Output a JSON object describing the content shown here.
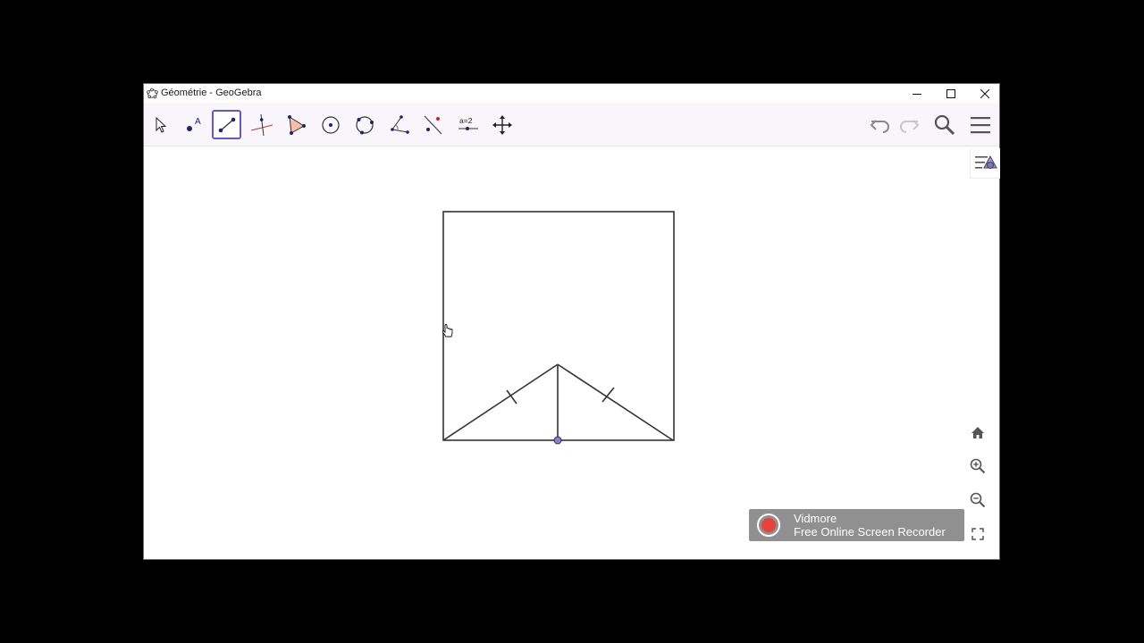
{
  "window": {
    "title": "Géométrie - GeoGebra",
    "controls": [
      "minimize-icon",
      "maximize-icon",
      "close-icon"
    ]
  },
  "toolbar": {
    "tools": [
      {
        "id": "move",
        "icon": "cursor-arrow-icon",
        "active": false
      },
      {
        "id": "point",
        "icon": "point-icon",
        "active": false
      },
      {
        "id": "segment",
        "icon": "segment-icon",
        "active": true
      },
      {
        "id": "perpendicular-line",
        "icon": "perpendicular-line-icon",
        "active": false
      },
      {
        "id": "polygon",
        "icon": "polygon-icon",
        "active": false
      },
      {
        "id": "circle-center-point",
        "icon": "circle-center-icon",
        "active": false
      },
      {
        "id": "circle-three-points",
        "icon": "circle-three-points-icon",
        "active": false
      },
      {
        "id": "angle",
        "icon": "angle-icon",
        "active": false
      },
      {
        "id": "reflect",
        "icon": "reflect-icon",
        "active": false
      },
      {
        "id": "slider",
        "icon": "slider-icon",
        "label": "a=2",
        "active": false
      },
      {
        "id": "move-graphics",
        "icon": "move-graphics-icon",
        "active": false
      }
    ],
    "right": [
      "undo-icon",
      "redo-icon",
      "search-icon",
      "menu-icon"
    ]
  },
  "nav_buttons": [
    "home-icon",
    "zoom-in-icon",
    "zoom-out-icon",
    "fullscreen-icon"
  ],
  "recorder": {
    "line1": "Vidmore",
    "line2": "Free Online Screen Recorder",
    "accent": "#e8423a"
  },
  "colors": {
    "active_tool_border": "#6557d2",
    "point_fill": "#8080e0",
    "stroke": "#333333"
  }
}
